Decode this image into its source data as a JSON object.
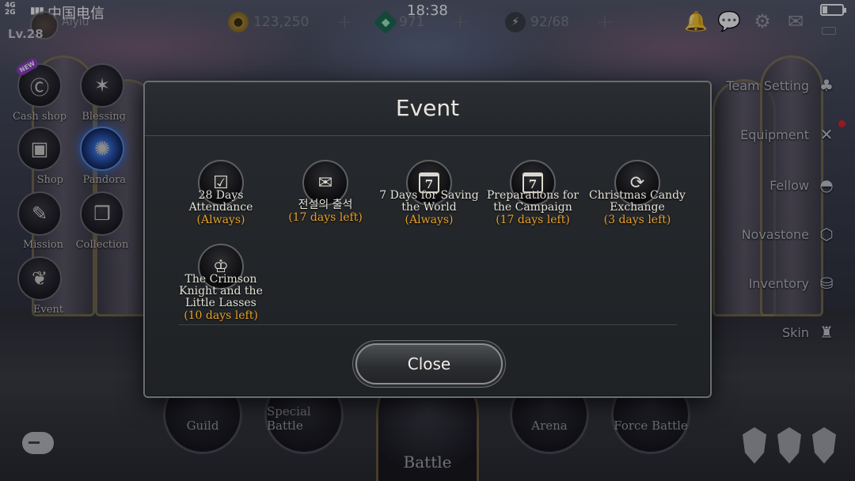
{
  "status_bar": {
    "signal_top": "4G",
    "signal_bottom": "2G",
    "carrier": "中国电信",
    "time": "18:38"
  },
  "player": {
    "level": "Lv.28",
    "name": "Aiyiu"
  },
  "resources": {
    "gold": "123,250",
    "gems": "971",
    "stamina": "92/68"
  },
  "left_menu": [
    {
      "label": "Cash shop",
      "icon": "cash-shop-icon",
      "badge": "NEW"
    },
    {
      "label": "Blessing",
      "icon": "blessing-icon"
    },
    {
      "label": "Shop",
      "icon": "shop-chest-icon"
    },
    {
      "label": "Pandora",
      "icon": "pandora-icon"
    },
    {
      "label": "Mission",
      "icon": "scroll-icon"
    },
    {
      "label": "Collection",
      "icon": "book-icon"
    },
    {
      "label": "Event",
      "icon": "gift-book-icon"
    }
  ],
  "right_menu": [
    {
      "label": "Team Setting",
      "icon": "team-icon"
    },
    {
      "label": "Equipment",
      "icon": "swords-icon"
    },
    {
      "label": "Fellow",
      "icon": "helmet-icon"
    },
    {
      "label": "Novastone",
      "icon": "novastone-icon"
    },
    {
      "label": "Inventory",
      "icon": "bag-icon"
    },
    {
      "label": "Skin",
      "icon": "armor-icon"
    }
  ],
  "bottom_menu": [
    {
      "label": "Guild"
    },
    {
      "label": "Special Battle"
    },
    {
      "label": "Battle"
    },
    {
      "label": "Arena"
    },
    {
      "label": "Force Battle"
    }
  ],
  "modal": {
    "title": "Event",
    "events": [
      {
        "name_lines": [
          "28 Days",
          "Attendance"
        ],
        "time": "(Always)",
        "icon": "checkbox-icon"
      },
      {
        "name_lines": [
          "전설의 출석"
        ],
        "time": "(17 days left)",
        "icon": "scroll-clock-icon"
      },
      {
        "name_lines": [
          "7 Days for Saving",
          "the World"
        ],
        "time": "(Always)",
        "icon": "calendar-icon",
        "icon_text": "7"
      },
      {
        "name_lines": [
          "Preparations for",
          "the Campaign"
        ],
        "time": "(17 days left)",
        "icon": "calendar-icon",
        "icon_text": "7"
      },
      {
        "name_lines": [
          "Christmas Candy",
          "Exchange"
        ],
        "time": "(3 days left)",
        "icon": "exchange-icon"
      },
      {
        "name_lines": [
          "The Crimson",
          "Knight and the",
          "Little Lasses"
        ],
        "time": "(10 days left)",
        "icon": "cup-icon"
      }
    ],
    "close_label": "Close"
  }
}
